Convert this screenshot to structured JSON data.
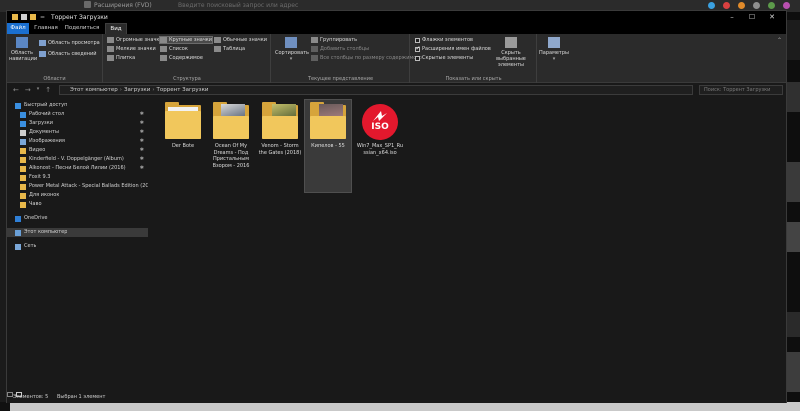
{
  "browser": {
    "tab_title": "Расширения (FVD)",
    "search_placeholder": "Введите поисковый запрос или адрес"
  },
  "window": {
    "title": "Торрент Загрузки",
    "quick_access_sep": "="
  },
  "tabs": [
    "Файл",
    "Главная",
    "Поделиться",
    "Вид"
  ],
  "ribbon": {
    "panes": {
      "label": "Области",
      "nav_pane": "Область навигации",
      "preview": "Область просмотра",
      "details": "Область сведений"
    },
    "layout": {
      "label": "Структура",
      "items": [
        "Огромные значки",
        "Крупные значки",
        "Обычные значки",
        "Мелкие значки",
        "Список",
        "Таблица",
        "Плитка",
        "Содержимое"
      ]
    },
    "current_view": {
      "label": "Текущее представление",
      "sort": "Сортировать",
      "group": "Группировать",
      "add_columns": "Добавить столбцы",
      "fit_columns": "Все столбцы по размеру содержимого"
    },
    "show_hide": {
      "label": "Показать или скрыть",
      "item_checkboxes": "Флажки элементов",
      "extensions": "Расширения имен файлов",
      "hidden": "Скрытые элементы",
      "hide_selected": "Скрыть выбранные элементы",
      "options": "Параметры"
    }
  },
  "address": {
    "path": [
      "Этот компьютер",
      "Загрузки",
      "Торрент Загрузки"
    ],
    "search_placeholder": "Поиск: Торрент Загрузки"
  },
  "nav": [
    {
      "label": "Быстрый доступ",
      "icon": "star-icon",
      "pinned": false
    },
    {
      "label": "Рабочий стол",
      "icon": "desktop-icon",
      "pinned": true
    },
    {
      "label": "Загрузки",
      "icon": "download-icon",
      "pinned": true
    },
    {
      "label": "Документы",
      "icon": "document-icon",
      "pinned": true
    },
    {
      "label": "Изображения",
      "icon": "pictures-icon",
      "pinned": true
    },
    {
      "label": "Видео",
      "icon": "folder-icon",
      "pinned": true
    },
    {
      "label": "Kinderfield - V. Doppelgänger (Album)",
      "icon": "folder-icon",
      "pinned": true
    },
    {
      "label": "Alkonost - Песни Белой Лилии (2016)",
      "icon": "folder-icon",
      "pinned": true
    },
    {
      "label": "Foxit 9.3",
      "icon": "folder-icon",
      "pinned": false
    },
    {
      "label": "Power Metal Attack - Special Ballads Edition (2CD) (2",
      "icon": "folder-icon",
      "pinned": false
    },
    {
      "label": "Для иконок",
      "icon": "folder-icon",
      "pinned": false
    },
    {
      "label": "Чаво",
      "icon": "folder-icon",
      "pinned": false
    },
    {
      "label": "OneDrive",
      "icon": "cloud-icon",
      "pinned": false
    },
    {
      "label": "Этот компьютер",
      "icon": "computer-icon",
      "pinned": false
    },
    {
      "label": "Сеть",
      "icon": "network-icon",
      "pinned": false
    }
  ],
  "files": [
    {
      "name": "Der Bote",
      "type": "folder"
    },
    {
      "name": "Ocean Of My Dreams - Под Пристальным Взором - 2016",
      "type": "folder"
    },
    {
      "name": "Venom - Storm the Gates (2018)",
      "type": "folder"
    },
    {
      "name": "Кипелов - 55",
      "type": "folder"
    },
    {
      "name": "Win7_Max_SP1_Russian_x64.iso",
      "type": "iso",
      "badge": "ISO"
    }
  ],
  "status": {
    "count": "Элементов: 5",
    "selected": "Выбран 1 элемент"
  }
}
